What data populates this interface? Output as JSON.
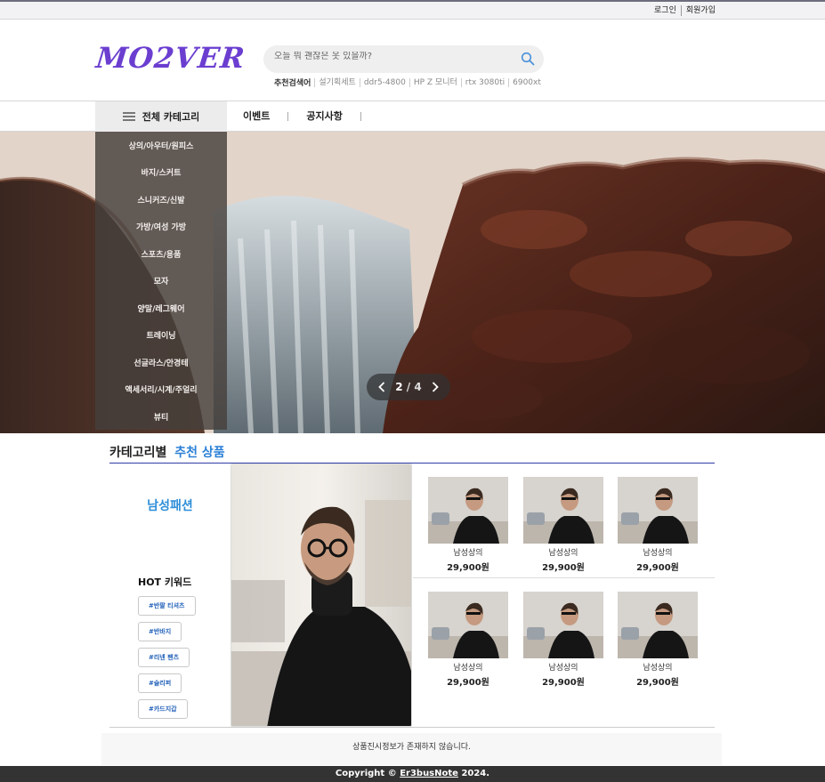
{
  "topbar": {
    "login": "로그인",
    "signup": "회원가입"
  },
  "header": {
    "logo": "MO2VER",
    "search_placeholder": "오늘 뭐 괜찮은 옷 있을까?",
    "recommended_label": "추천검색어",
    "recommended_keywords": [
      "설기획세트",
      "ddr5-4800",
      "HP Z 모니터",
      "rtx 3080ti",
      "6900xt"
    ]
  },
  "nav": {
    "all_categories": "전체 카테고리",
    "menu": [
      "이벤트",
      "공지사항"
    ]
  },
  "category_menu": [
    "상의/아우터/원피스",
    "바지/스커트",
    "스니커즈/신발",
    "가방/여성 가방",
    "스포츠/용품",
    "모자",
    "양말/레그웨어",
    "트레이닝",
    "선글라스/안경테",
    "액세서리/시계/주얼리",
    "뷰티"
  ],
  "slider": {
    "current": "2",
    "separator": "/",
    "total": "4"
  },
  "section": {
    "title": "카테고리별",
    "title_highlight": "추천 상품",
    "category_name": "남성패션",
    "hot_keywords_title": "HOT 키워드",
    "hot_keywords": [
      "#반팔 티셔츠",
      "#반바지",
      "#리넨 팬츠",
      "#슬리퍼",
      "#카드지갑"
    ]
  },
  "products": [
    {
      "name": "남성상의",
      "price": "29,900원"
    },
    {
      "name": "남성상의",
      "price": "29,900원"
    },
    {
      "name": "남성상의",
      "price": "29,900원"
    },
    {
      "name": "남성상의",
      "price": "29,900원"
    },
    {
      "name": "남성상의",
      "price": "29,900원"
    },
    {
      "name": "남성상의",
      "price": "29,900원"
    }
  ],
  "notice": "상품진시정보가 존재하지 않습니다.",
  "footer": {
    "prefix": "Copyright ©",
    "brand": "Er3busNote",
    "year": "2024."
  },
  "colors": {
    "accent": "#6b3ed0",
    "link_blue": "#2b80d6",
    "footer_bg": "#333333"
  }
}
